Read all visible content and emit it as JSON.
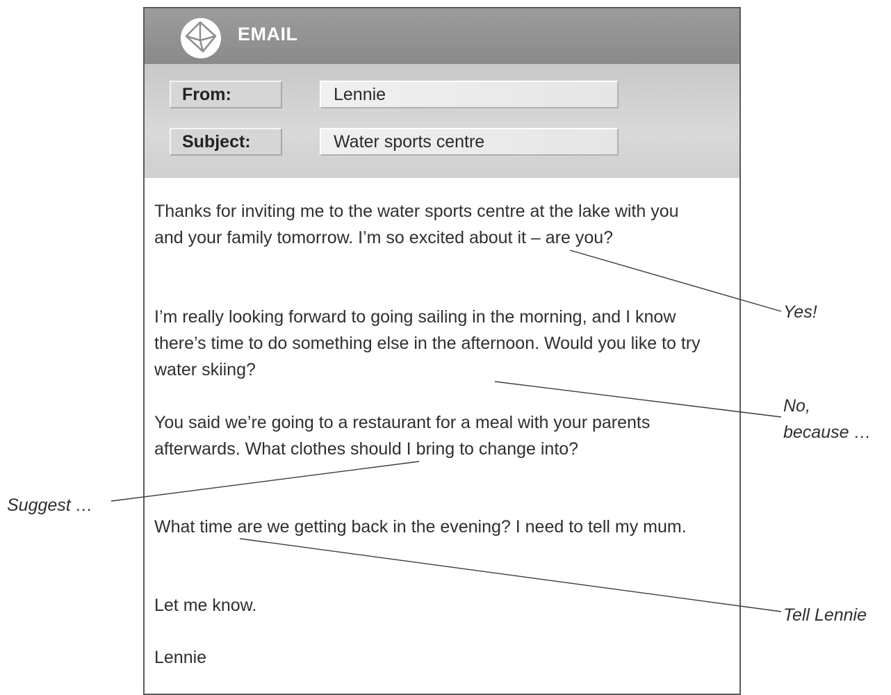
{
  "email": {
    "title": "EMAIL",
    "icon": "envelope-icon",
    "from_label": "From:",
    "from_value": "Lennie",
    "subject_label": "Subject:",
    "subject_value": "Water sports centre",
    "paragraphs": [
      "Thanks for inviting me to the water sports centre at the lake with you and your family tomorrow. I’m so excited about it – are you?",
      "I’m really looking forward to going sailing in the morning, and I know there’s time to do something else in the afternoon. Would you like to try water skiing?",
      "You said we’re going to a restaurant for a meal with your parents afterwards. What clothes should I bring to change into?",
      "What time are we getting back in the evening? I need to tell my mum.",
      "Let me know.",
      "Lennie"
    ]
  },
  "annotations": {
    "yes": "Yes!",
    "no_because_line1": "No,",
    "no_because_line2": "because …",
    "suggest": "Suggest …",
    "tell_lennie": "Tell Lennie"
  },
  "colors": {
    "header_bar": "#8f8f8f",
    "fields_panel": "#d2d2d2",
    "border": "#5a5a5a",
    "text": "#2f2f2f"
  }
}
